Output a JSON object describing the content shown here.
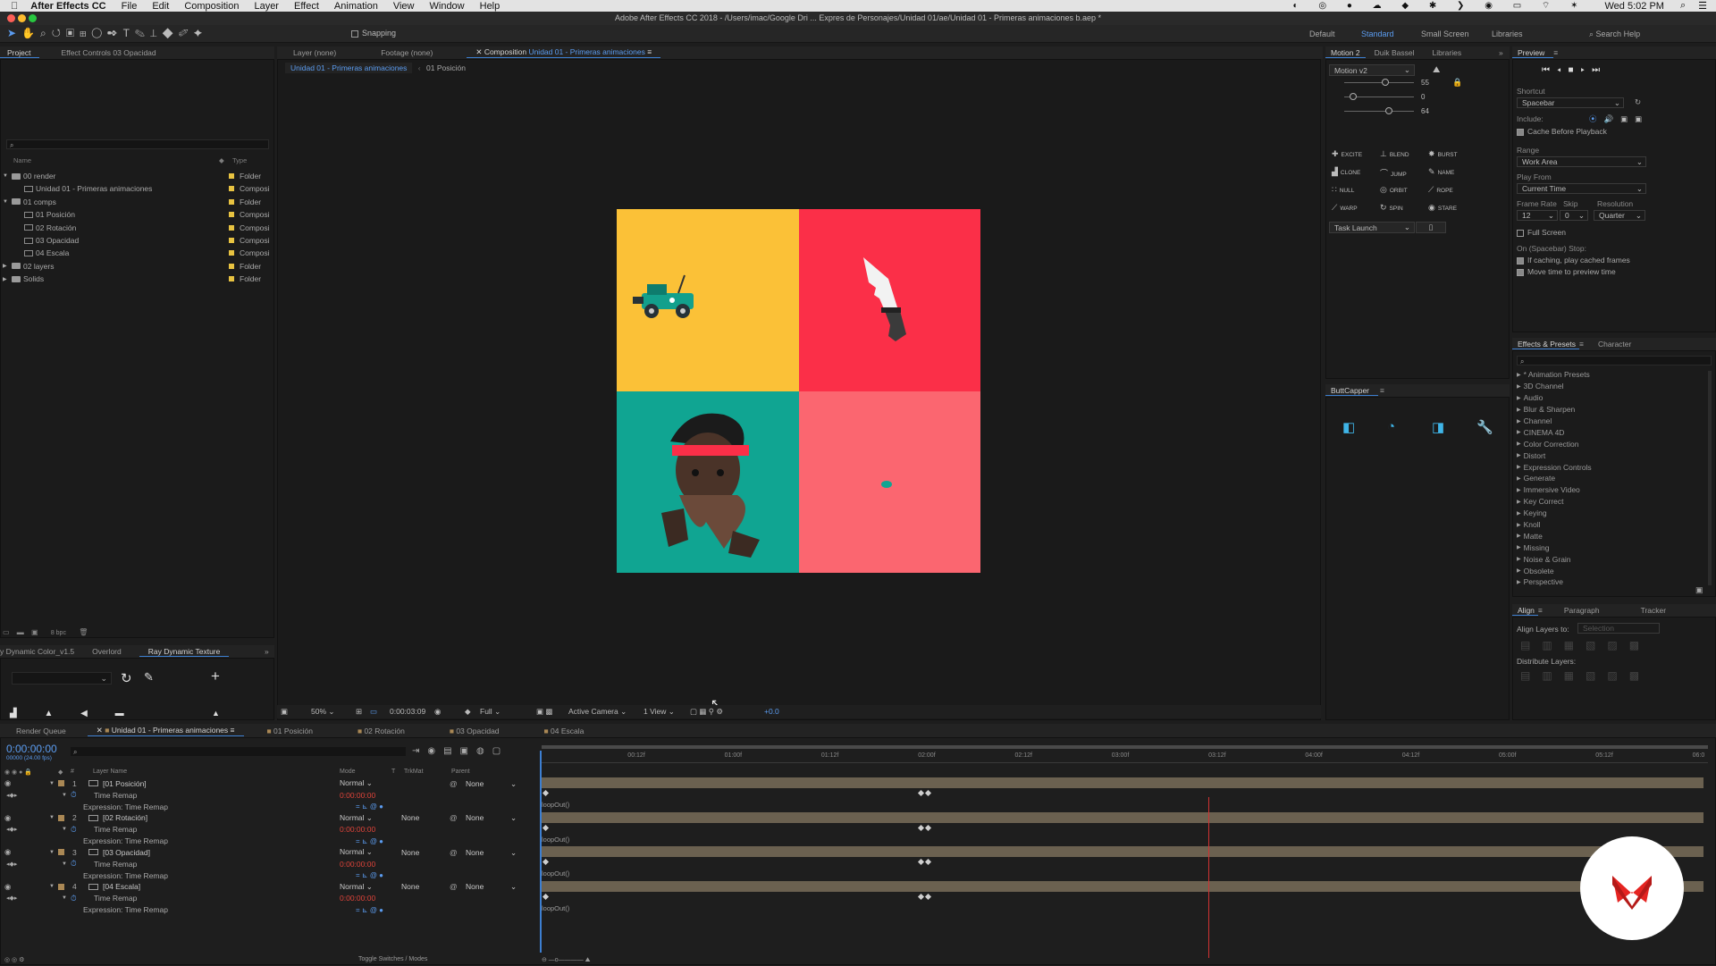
{
  "app": {
    "name": "After Effects CC",
    "apple": "",
    "clock": "Wed 5:02 PM"
  },
  "menu": [
    "File",
    "Edit",
    "Composition",
    "Layer",
    "Effect",
    "Animation",
    "View",
    "Window",
    "Help"
  ],
  "title": "Adobe After Effects CC 2018 - /Users/imac/Google Dri ... Expres de Personajes/Unidad 01/ae/Unidad 01 - Primeras animaciones b.aep *",
  "toolbar": {
    "snapping": "Snapping",
    "workspaces": [
      "Default",
      "Standard",
      "Small Screen",
      "Libraries"
    ],
    "search": "Search Help"
  },
  "project": {
    "tabs": [
      "Project",
      "Effect Controls 03 Opacidad"
    ],
    "col_name": "Name",
    "col_type": "Type",
    "items": [
      {
        "name": "00 render",
        "type": "Folder",
        "kind": "folder",
        "indent": 0,
        "tw": "▼"
      },
      {
        "name": "Unidad 01 - Primeras animaciones",
        "type": "Composi",
        "kind": "comp",
        "indent": 1,
        "tw": ""
      },
      {
        "name": "01 comps",
        "type": "Folder",
        "kind": "folder",
        "indent": 0,
        "tw": "▼"
      },
      {
        "name": "01 Posición",
        "type": "Composi",
        "kind": "comp",
        "indent": 1,
        "tw": ""
      },
      {
        "name": "02 Rotación",
        "type": "Composi",
        "kind": "comp",
        "indent": 1,
        "tw": ""
      },
      {
        "name": "03 Opacidad",
        "type": "Composi",
        "kind": "comp",
        "indent": 1,
        "tw": ""
      },
      {
        "name": "04 Escala",
        "type": "Composi",
        "kind": "comp",
        "indent": 1,
        "tw": ""
      },
      {
        "name": "02 layers",
        "type": "Folder",
        "kind": "folder",
        "indent": 0,
        "tw": "▶"
      },
      {
        "name": "Solids",
        "type": "Folder",
        "kind": "folder",
        "indent": 0,
        "tw": "▶"
      }
    ],
    "bpc": "8 bpc"
  },
  "plugins": {
    "tabs": [
      "y Dynamic Color_v1.5",
      "Overlord",
      "Ray Dynamic Texture"
    ]
  },
  "viewer": {
    "tabs": [
      "Layer (none)",
      "Footage (none)",
      "Composition",
      "Unidad 01 - Primeras animaciones"
    ],
    "breadcrumbs": [
      "Unidad 01 - Primeras animaciones",
      "01 Posición"
    ],
    "zoom": "50%",
    "timecode": "0:00:03:09",
    "resolution": "Full",
    "camera": "Active Camera",
    "views": "1 View",
    "exposure": "+0.0"
  },
  "motion": {
    "tabs": [
      "Motion 2",
      "Duik Bassel",
      "Libraries"
    ],
    "preset": "Motion v2",
    "sliders": [
      "55",
      "0",
      "64"
    ],
    "buttons": [
      "EXCITE",
      "BLEND",
      "BURST",
      "CLONE",
      "JUMP",
      "NAME",
      "NULL",
      "ORBIT",
      "ROPE",
      "WARP",
      "SPIN",
      "STARE"
    ],
    "task": "Task Launch"
  },
  "buttcapper": {
    "title": "ButtCapper"
  },
  "preview": {
    "title": "Preview",
    "shortcut_label": "Shortcut",
    "shortcut": "Spacebar",
    "include_label": "Include:",
    "cache": "Cache Before Playback",
    "range_label": "Range",
    "range": "Work Area",
    "play_from_label": "Play From",
    "play_from": "Current Time",
    "frame_rate_label": "Frame Rate",
    "skip_label": "Skip",
    "resolution_label": "Resolution",
    "frame_rate": "12",
    "skip": "0",
    "resolution": "Quarter",
    "full_screen": "Full Screen",
    "stop_label": "On (Spacebar) Stop:",
    "stop_opt1": "If caching, play cached frames",
    "stop_opt2": "Move time to preview time"
  },
  "effects": {
    "tabs": [
      "Effects & Presets",
      "Character"
    ],
    "items": [
      "* Animation Presets",
      "3D Channel",
      "Audio",
      "Blur & Sharpen",
      "Channel",
      "CINEMA 4D",
      "Color Correction",
      "Distort",
      "Expression Controls",
      "Generate",
      "Immersive Video",
      "Key Correct",
      "Keying",
      "Knoll",
      "Matte",
      "Missing",
      "Noise & Grain",
      "Obsolete",
      "Perspective"
    ]
  },
  "align": {
    "tabs": [
      "Align",
      "Paragraph",
      "Tracker"
    ],
    "align_to": "Align Layers to:",
    "selection": "Selection",
    "distribute": "Distribute Layers:"
  },
  "timeline": {
    "tabs": [
      "Render Queue",
      "Unidad 01 - Primeras animaciones",
      "01 Posición",
      "02 Rotación",
      "03 Opacidad",
      "04 Escala"
    ],
    "current_time": "0:00:00:00",
    "fps": "00000 (24.00 fps)",
    "col_layer": "Layer Name",
    "col_mode": "Mode",
    "col_t": "T",
    "col_trkmat": "TrkMat",
    "col_parent": "Parent",
    "ruler": [
      "00:12f",
      "01:00f",
      "01:12f",
      "02:00f",
      "02:12f",
      "03:00f",
      "03:12f",
      "04:00f",
      "04:12f",
      "05:00f",
      "05:12f",
      "06:0"
    ],
    "layers": [
      {
        "num": "1",
        "name": "[01 Posición]",
        "mode": "Normal",
        "trkmat": "",
        "parent": "None"
      },
      {
        "num": "2",
        "name": "[02 Rotación]",
        "mode": "Normal",
        "trkmat": "None",
        "parent": "None"
      },
      {
        "num": "3",
        "name": "[03 Opacidad]",
        "mode": "Normal",
        "trkmat": "None",
        "parent": "None"
      },
      {
        "num": "4",
        "name": "[04 Escala]",
        "mode": "Normal",
        "trkmat": "None",
        "parent": "None"
      }
    ],
    "time_remap": "Time Remap",
    "expression": "Expression: Time Remap",
    "remap_value": "0:00:00:00",
    "loop": "loopOut()",
    "toggle": "Toggle Switches / Modes"
  },
  "colors": {
    "accent": "#3d7fd1",
    "yellow": "#fbc137",
    "red": "#fb2f48",
    "teal": "#10a592",
    "pink": "#fb6670",
    "playhead": "#d23232"
  }
}
